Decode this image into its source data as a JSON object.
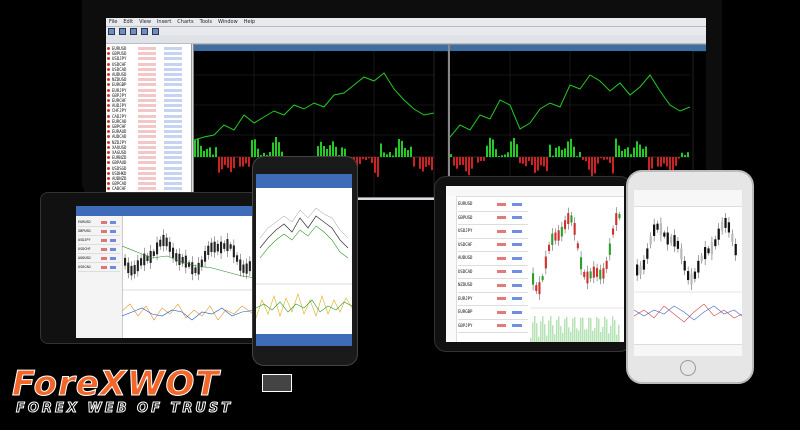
{
  "brand": {
    "logo_text": "ForeXWOT",
    "tagline": "FOREX WEB OF TRUST",
    "accent": "#f2662a"
  },
  "desktop": {
    "menu": [
      "File",
      "Edit",
      "View",
      "Insert",
      "Charts",
      "Tools",
      "Window",
      "Help"
    ],
    "toolbar_icons": [
      "new-order-icon",
      "autotrading-icon",
      "zoom-in-icon",
      "zoom-out-icon",
      "grid-icon"
    ],
    "market_watch": {
      "symbols": [
        "EURUSD",
        "GBPUSD",
        "USDJPY",
        "USDCHF",
        "USDCAD",
        "AUDUSD",
        "NZDUSD",
        "EURGBP",
        "EURJPY",
        "GBPJPY",
        "EURCHF",
        "AUDJPY",
        "CHFJPY",
        "CADJPY",
        "EURCAD",
        "GBPCHF",
        "EURAUD",
        "AUDCAD",
        "NZDJPY",
        "XAUUSD",
        "XAGUSD",
        "EURNZD",
        "GBPAUD",
        "USDSGD",
        "USDHKD",
        "AUDNZD",
        "GBPCAD",
        "CADCHF",
        "EURSEK"
      ]
    },
    "chart_colors": {
      "up": "#22cc22",
      "down": "#cc2222",
      "bg": "#000000"
    }
  },
  "mobile": {
    "quote_symbols": [
      "EURUSD",
      "GBPUSD",
      "USDJPY",
      "USDCHF",
      "AUDUSD",
      "USDCAD",
      "NZDUSD",
      "EURJPY",
      "EURGBP",
      "GBPJPY"
    ],
    "tabs_icons": [
      "quotes-icon",
      "chart-icon",
      "trade-icon",
      "history-icon",
      "settings-icon"
    ]
  }
}
